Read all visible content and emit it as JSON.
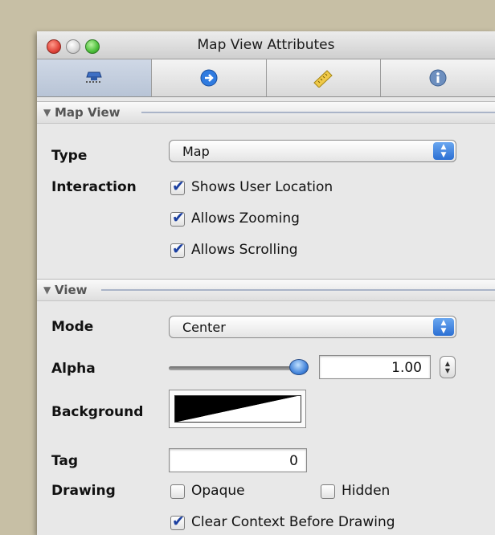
{
  "window": {
    "title": "Map View Attributes"
  },
  "tabs": [
    {
      "icon": "map-view-icon",
      "active": true
    },
    {
      "icon": "connections-arrow-icon",
      "active": false
    },
    {
      "icon": "size-ruler-icon",
      "active": false
    },
    {
      "icon": "info-icon",
      "active": false
    }
  ],
  "map_view": {
    "header": "Map View",
    "type_label": "Type",
    "type_value": "Map",
    "interaction_label": "Interaction",
    "shows_user_location": {
      "label": "Shows User Location",
      "checked": true
    },
    "allows_zooming": {
      "label": "Allows Zooming",
      "checked": true
    },
    "allows_scrolling": {
      "label": "Allows Scrolling",
      "checked": true
    }
  },
  "view": {
    "header": "View",
    "mode_label": "Mode",
    "mode_value": "Center",
    "alpha_label": "Alpha",
    "alpha_value": "1.00",
    "alpha_level": 1.0,
    "background_label": "Background",
    "tag_label": "Tag",
    "tag_value": "0",
    "drawing_label": "Drawing",
    "opaque": {
      "label": "Opaque",
      "checked": false
    },
    "hidden": {
      "label": "Hidden",
      "checked": false
    },
    "clear_context": {
      "label": "Clear Context Before Drawing",
      "checked": true
    }
  },
  "colors": {
    "accent": "#2b6fd3",
    "background": "#c7bfa5"
  }
}
